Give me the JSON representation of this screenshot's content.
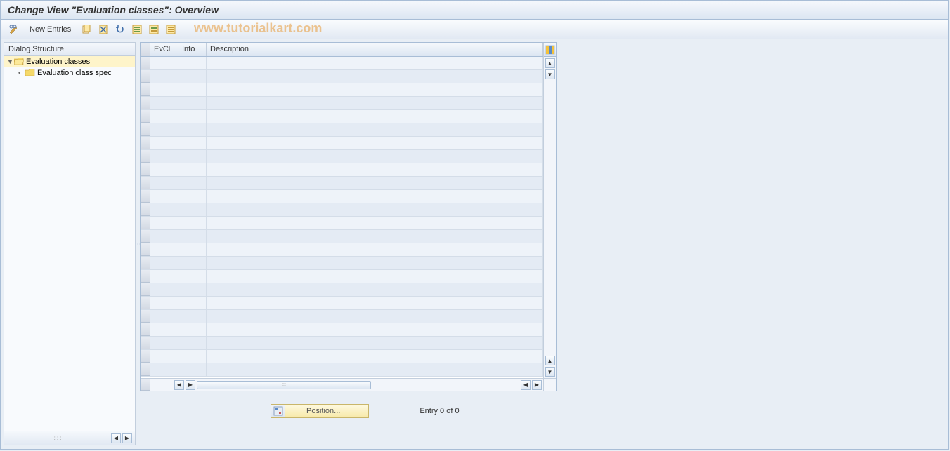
{
  "title": "Change View \"Evaluation classes\": Overview",
  "toolbar": {
    "new_entries_label": "New Entries"
  },
  "watermark": "www.tutorialkart.com",
  "sidebar": {
    "header": "Dialog Structure",
    "items": [
      {
        "label": "Evaluation classes",
        "selected": true,
        "open": true
      },
      {
        "label": "Evaluation class spec",
        "selected": false,
        "open": false
      }
    ]
  },
  "table": {
    "columns": {
      "evcl": "EvCl",
      "info": "Info",
      "description": "Description"
    },
    "row_count": 24,
    "rows": []
  },
  "footer": {
    "position_label": "Position...",
    "entry_status": "Entry 0 of 0"
  }
}
